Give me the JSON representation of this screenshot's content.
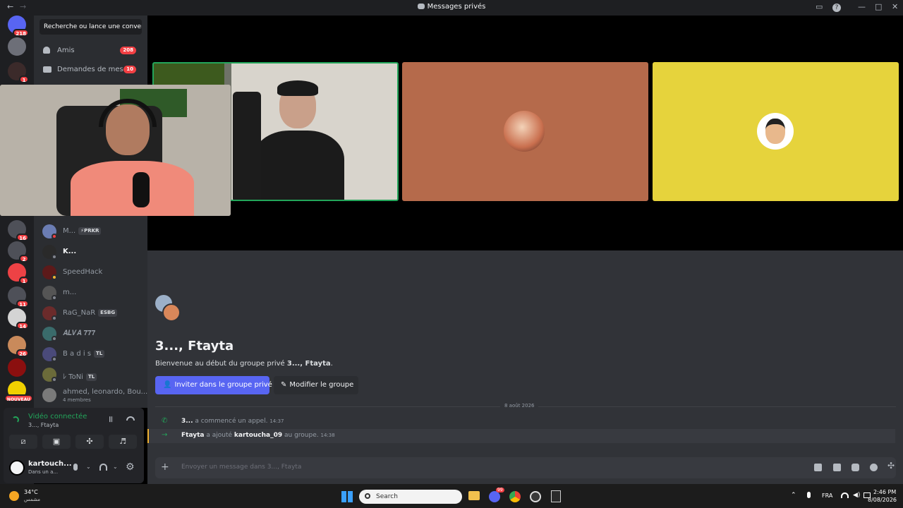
{
  "window": {
    "title": "Messages privés",
    "back": "←",
    "forward": "→",
    "controls": [
      "▭",
      "?",
      "—",
      "□",
      "✕"
    ]
  },
  "rail": {
    "servers": [
      {
        "name": "discord-home-icon",
        "badge": "218",
        "color": "#5865f2"
      },
      {
        "name": "server-2",
        "badge": "",
        "color": "#6d6f78"
      },
      {
        "name": "server-3",
        "badge": "1",
        "color": "#3b2a2a"
      },
      {
        "name": "server-4",
        "badge": "16",
        "color": "#4e5058"
      },
      {
        "name": "server-5",
        "badge": "2",
        "color": "#4e5058"
      },
      {
        "name": "server-6",
        "badge": "1",
        "color": "#ed4245"
      },
      {
        "name": "server-7",
        "badge": "11",
        "color": "#4e5058"
      },
      {
        "name": "server-8",
        "badge": "14",
        "color": "#d4d4d4"
      },
      {
        "name": "server-9",
        "badge": "26",
        "color": "#c98a5b"
      },
      {
        "name": "server-10",
        "badge": "",
        "color": "#8b0f0f"
      },
      {
        "name": "server-11",
        "badge": "NOUVEAU",
        "color": "#f0d000"
      }
    ]
  },
  "sidebar": {
    "search_placeholder": "Recherche ou lance une conver...",
    "friends": {
      "label": "Amis",
      "badge": "208"
    },
    "requests": {
      "label": "Demandes de mes...",
      "badge": "10"
    },
    "dms": [
      {
        "name": "M...",
        "tag": "⚡PRKR",
        "status": "dnd"
      },
      {
        "name": "K...",
        "tag": "",
        "status": "offline"
      },
      {
        "name": "SpeedHack",
        "tag": "",
        "status": "idle"
      },
      {
        "name": "m...",
        "tag": "",
        "status": "offline"
      },
      {
        "name": "RaG_NaR",
        "tag": "ESBG",
        "status": "offline"
      },
      {
        "name": "𝑨𝑳𝑽𝑨 𝟕𝟕𝟕",
        "tag": "",
        "status": "offline"
      },
      {
        "name": "B a d i s",
        "tag": "TL",
        "status": "offline"
      },
      {
        "name": "ﾚ ToNi",
        "tag": "TL",
        "status": "offline"
      }
    ],
    "group": {
      "name": "ahmed, leonardo, Bou...",
      "members": "4 membres"
    }
  },
  "voice": {
    "status": "Vidéo connectée",
    "channel": "3..., Ftayta"
  },
  "user": {
    "name": "kartouch...",
    "status": "Dans un a..."
  },
  "chat": {
    "title": "3..., Ftayta",
    "intro_prefix": "Bienvenue au début du groupe privé ",
    "intro_bold": "3..., Ftayta",
    "intro_suffix": ".",
    "invite_button": "Inviter dans le groupe privé",
    "edit_button": "Modifier le groupe",
    "date_divider": "8 août 2026",
    "messages": [
      {
        "author": "3...",
        "text": " a commencé un appel.",
        "time": "14:37"
      },
      {
        "author": "Ftayta",
        "text": " a ajouté ",
        "target": "kartoucha_09",
        "suffix": " au groupe.",
        "time": "14:38"
      }
    ],
    "input_placeholder": "Envoyer un message dans 3..., Ftayta"
  },
  "taskbar": {
    "weather_temp": "34°C",
    "weather_desc": "مشمس",
    "search": "Search",
    "lang": "FRA",
    "time": "2:46 PM",
    "date": "8/08/2026",
    "discord_badge": "99"
  },
  "colors": {
    "accent": "#5865f2",
    "speaking": "#23a55a",
    "tile_orange": "#b56a4b",
    "tile_yellow": "#e6d33c"
  }
}
